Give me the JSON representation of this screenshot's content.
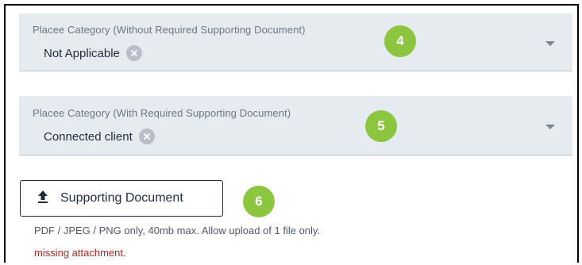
{
  "fields": [
    {
      "label": "Placee Category (Without Required Supporting Document)",
      "selected_chip": "Not Applicable",
      "step_number": "4"
    },
    {
      "label": "Placee Category (With Required Supporting Document)",
      "selected_chip": "Connected client",
      "step_number": "5"
    }
  ],
  "upload": {
    "button_label": "Supporting Document",
    "step_number": "6",
    "hint": "PDF / JPEG / PNG only, 40mb max. Allow upload of 1 file only.",
    "error": "missing attachment."
  },
  "icons": {
    "chip_remove": "close-circle-icon",
    "dropdown": "chevron-down-icon",
    "upload": "upload-icon"
  },
  "colors": {
    "field_background": "#e6ebf0",
    "step_badge": "#8cc63f",
    "error_text": "#b3261e",
    "chip_remove_bg": "#b7bfc8"
  }
}
